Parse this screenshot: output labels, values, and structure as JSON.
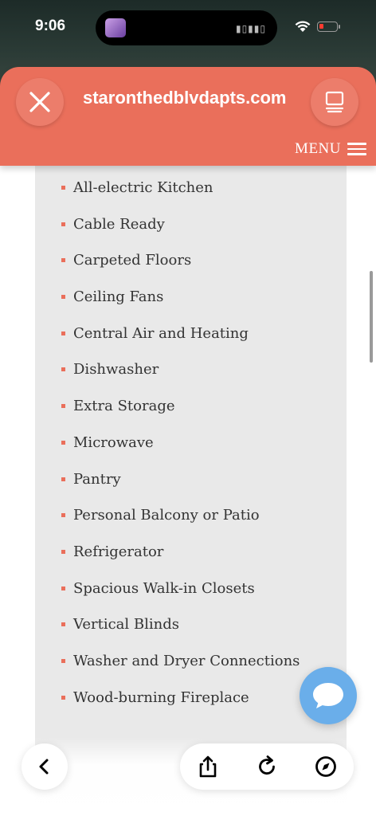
{
  "status_bar": {
    "time": "9:06"
  },
  "browser": {
    "url": "staronthedblvdapts.com",
    "icons": {
      "close": "close-icon",
      "tabs": "tabs-icon",
      "back": "chevron-left-icon",
      "share": "share-icon",
      "reload": "reload-icon",
      "safari": "compass-icon"
    }
  },
  "header": {
    "menu_label": "MENU",
    "color": "#ea6f5b"
  },
  "amenities": [
    "All-electric Kitchen",
    "Cable Ready",
    "Carpeted Floors",
    "Ceiling Fans",
    "Central Air and Heating",
    "Dishwasher",
    "Extra Storage",
    "Microwave",
    "Pantry",
    "Personal Balcony or Patio",
    "Refrigerator",
    "Spacious Walk-in Closets",
    "Vertical Blinds",
    "Washer and Dryer Connections",
    "Wood-burning Fireplace"
  ],
  "chat": {
    "icon": "chat-bubble-icon",
    "color": "#6aaeea"
  }
}
